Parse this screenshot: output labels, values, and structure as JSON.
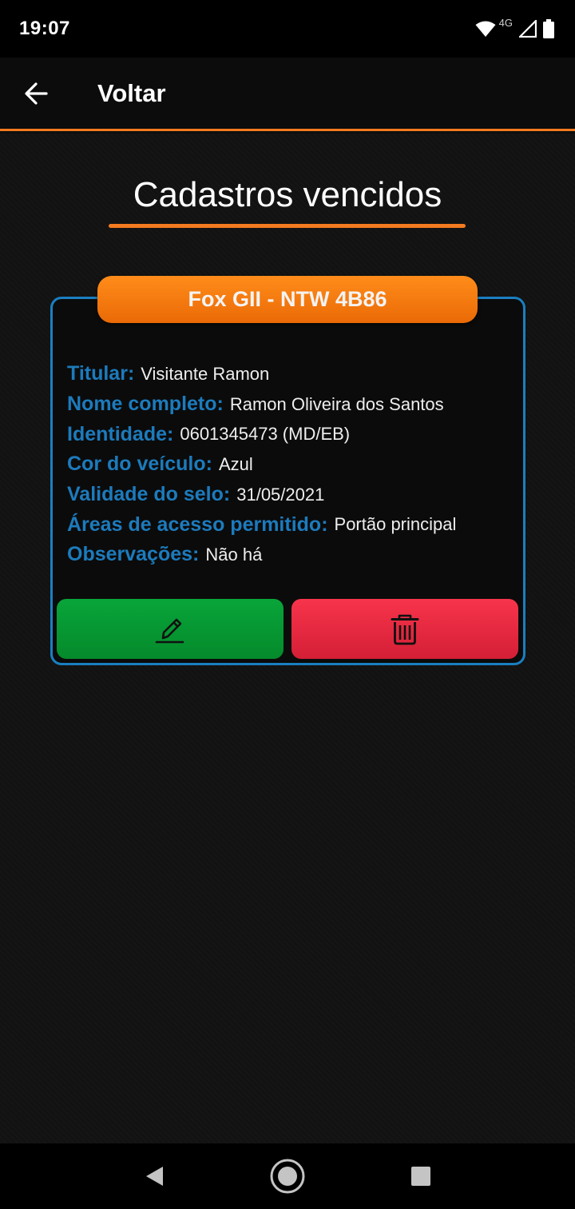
{
  "status_bar": {
    "time": "19:07",
    "network": "4G",
    "icons": [
      "wifi-icon",
      "signal-icon",
      "battery-icon"
    ]
  },
  "app_bar": {
    "back_icon": "arrow-left-icon",
    "title": "Voltar"
  },
  "page": {
    "heading": "Cadastros vencidos"
  },
  "card": {
    "tag": "Fox GII - NTW 4B86",
    "fields": [
      {
        "label": "Titular:",
        "value": "Visitante Ramon"
      },
      {
        "label": "Nome completo:",
        "value": "Ramon Oliveira dos Santos"
      },
      {
        "label": "Identidade:",
        "value": "0601345473 (MD/EB)"
      },
      {
        "label": "Cor do veículo:",
        "value": "Azul"
      },
      {
        "label": "Validade do selo:",
        "value": "31/05/2021"
      },
      {
        "label": "Áreas de acesso permitido:",
        "value": "Portão principal"
      },
      {
        "label": "Observações:",
        "value": "Não há"
      }
    ],
    "edit_icon": "pencil-icon",
    "delete_icon": "trash-icon"
  },
  "colors": {
    "accent_orange": "#f47a1f",
    "card_border_blue": "#1a7fc1",
    "label_blue": "#1c7bbd",
    "edit_green": "#08a53a",
    "delete_red": "#f7344b"
  },
  "nav_bar": {
    "icons": [
      "back-triangle-icon",
      "home-circle-icon",
      "recents-square-icon"
    ]
  }
}
